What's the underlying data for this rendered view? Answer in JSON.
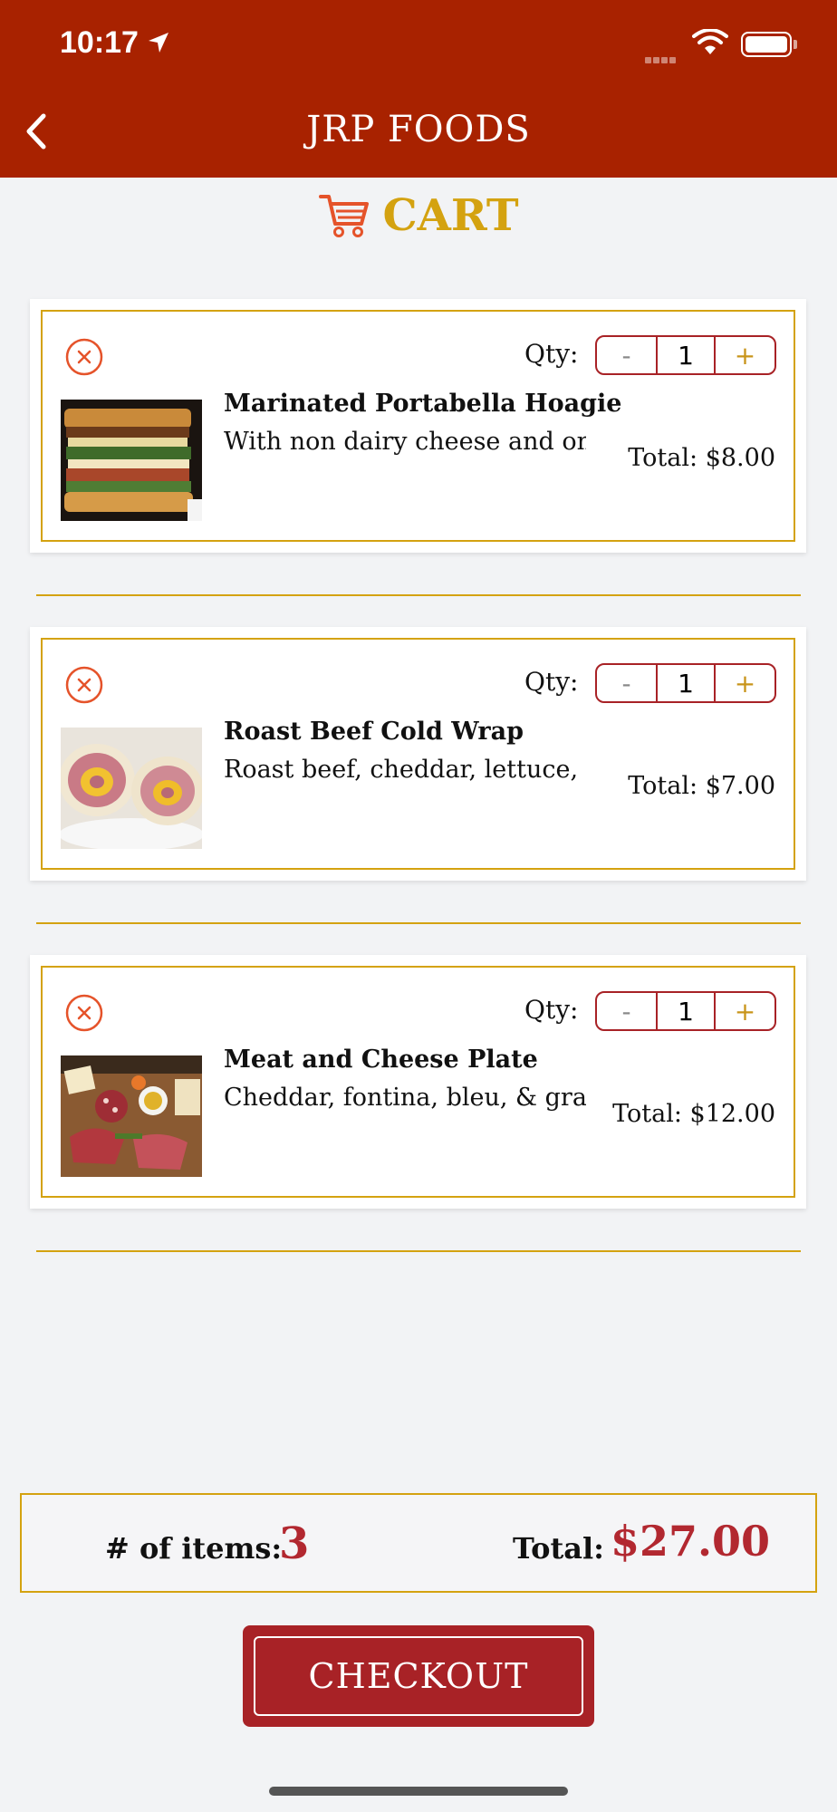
{
  "status_bar": {
    "time": "10:17"
  },
  "header": {
    "title": "JRP FOODS",
    "back_icon": "chevron-left-icon"
  },
  "cart": {
    "title": "CART",
    "icon": "shopping-cart-icon"
  },
  "items": [
    {
      "name": "Marinated Portabella Hoagie",
      "description": "With non dairy cheese and onions",
      "qty_label": "Qty:",
      "qty": "1",
      "total": "Total: $8.00",
      "minus": "-",
      "plus": "+"
    },
    {
      "name": "Roast Beef Cold Wrap",
      "description": "Roast beef, cheddar, lettuce, to...",
      "qty_label": "Qty:",
      "qty": "1",
      "total": "Total: $7.00",
      "minus": "-",
      "plus": "+"
    },
    {
      "name": "Meat and Cheese Plate",
      "description": "Cheddar, fontina, bleu, & gran c...",
      "qty_label": "Qty:",
      "qty": "1",
      "total": "Total: $12.00",
      "minus": "-",
      "plus": "+"
    }
  ],
  "summary": {
    "count_label": "# of items:",
    "count": "3",
    "total_label": "Total:",
    "total": "$27.00"
  },
  "checkout": {
    "label": "CHECKOUT"
  },
  "colors": {
    "header": "#a82200",
    "accent_gold": "#d4a210",
    "accent_red": "#b22830",
    "cart_icon": "#e5532a"
  }
}
